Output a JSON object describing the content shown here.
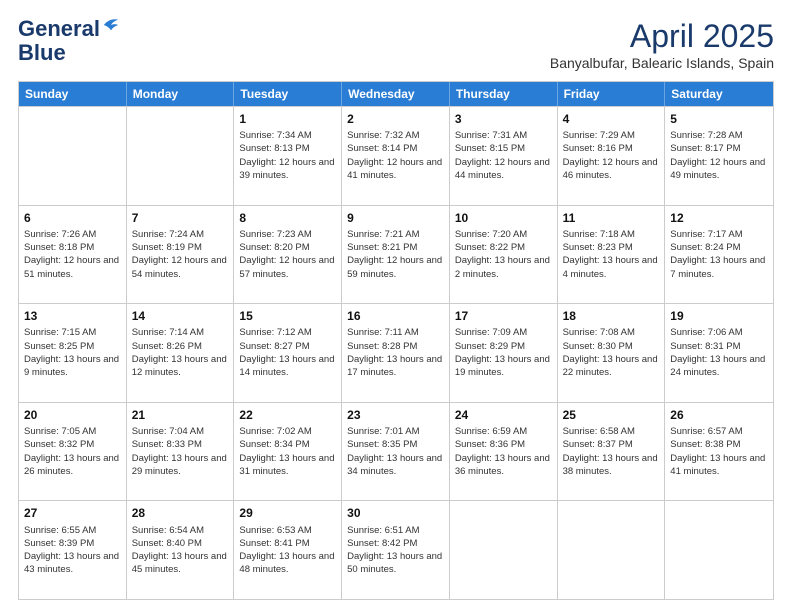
{
  "logo": {
    "general": "General",
    "blue": "Blue"
  },
  "title": "April 2025",
  "subtitle": "Banyalbufar, Balearic Islands, Spain",
  "headers": [
    "Sunday",
    "Monday",
    "Tuesday",
    "Wednesday",
    "Thursday",
    "Friday",
    "Saturday"
  ],
  "weeks": [
    [
      {
        "day": "",
        "info": ""
      },
      {
        "day": "",
        "info": ""
      },
      {
        "day": "1",
        "info": "Sunrise: 7:34 AM\nSunset: 8:13 PM\nDaylight: 12 hours and 39 minutes."
      },
      {
        "day": "2",
        "info": "Sunrise: 7:32 AM\nSunset: 8:14 PM\nDaylight: 12 hours and 41 minutes."
      },
      {
        "day": "3",
        "info": "Sunrise: 7:31 AM\nSunset: 8:15 PM\nDaylight: 12 hours and 44 minutes."
      },
      {
        "day": "4",
        "info": "Sunrise: 7:29 AM\nSunset: 8:16 PM\nDaylight: 12 hours and 46 minutes."
      },
      {
        "day": "5",
        "info": "Sunrise: 7:28 AM\nSunset: 8:17 PM\nDaylight: 12 hours and 49 minutes."
      }
    ],
    [
      {
        "day": "6",
        "info": "Sunrise: 7:26 AM\nSunset: 8:18 PM\nDaylight: 12 hours and 51 minutes."
      },
      {
        "day": "7",
        "info": "Sunrise: 7:24 AM\nSunset: 8:19 PM\nDaylight: 12 hours and 54 minutes."
      },
      {
        "day": "8",
        "info": "Sunrise: 7:23 AM\nSunset: 8:20 PM\nDaylight: 12 hours and 57 minutes."
      },
      {
        "day": "9",
        "info": "Sunrise: 7:21 AM\nSunset: 8:21 PM\nDaylight: 12 hours and 59 minutes."
      },
      {
        "day": "10",
        "info": "Sunrise: 7:20 AM\nSunset: 8:22 PM\nDaylight: 13 hours and 2 minutes."
      },
      {
        "day": "11",
        "info": "Sunrise: 7:18 AM\nSunset: 8:23 PM\nDaylight: 13 hours and 4 minutes."
      },
      {
        "day": "12",
        "info": "Sunrise: 7:17 AM\nSunset: 8:24 PM\nDaylight: 13 hours and 7 minutes."
      }
    ],
    [
      {
        "day": "13",
        "info": "Sunrise: 7:15 AM\nSunset: 8:25 PM\nDaylight: 13 hours and 9 minutes."
      },
      {
        "day": "14",
        "info": "Sunrise: 7:14 AM\nSunset: 8:26 PM\nDaylight: 13 hours and 12 minutes."
      },
      {
        "day": "15",
        "info": "Sunrise: 7:12 AM\nSunset: 8:27 PM\nDaylight: 13 hours and 14 minutes."
      },
      {
        "day": "16",
        "info": "Sunrise: 7:11 AM\nSunset: 8:28 PM\nDaylight: 13 hours and 17 minutes."
      },
      {
        "day": "17",
        "info": "Sunrise: 7:09 AM\nSunset: 8:29 PM\nDaylight: 13 hours and 19 minutes."
      },
      {
        "day": "18",
        "info": "Sunrise: 7:08 AM\nSunset: 8:30 PM\nDaylight: 13 hours and 22 minutes."
      },
      {
        "day": "19",
        "info": "Sunrise: 7:06 AM\nSunset: 8:31 PM\nDaylight: 13 hours and 24 minutes."
      }
    ],
    [
      {
        "day": "20",
        "info": "Sunrise: 7:05 AM\nSunset: 8:32 PM\nDaylight: 13 hours and 26 minutes."
      },
      {
        "day": "21",
        "info": "Sunrise: 7:04 AM\nSunset: 8:33 PM\nDaylight: 13 hours and 29 minutes."
      },
      {
        "day": "22",
        "info": "Sunrise: 7:02 AM\nSunset: 8:34 PM\nDaylight: 13 hours and 31 minutes."
      },
      {
        "day": "23",
        "info": "Sunrise: 7:01 AM\nSunset: 8:35 PM\nDaylight: 13 hours and 34 minutes."
      },
      {
        "day": "24",
        "info": "Sunrise: 6:59 AM\nSunset: 8:36 PM\nDaylight: 13 hours and 36 minutes."
      },
      {
        "day": "25",
        "info": "Sunrise: 6:58 AM\nSunset: 8:37 PM\nDaylight: 13 hours and 38 minutes."
      },
      {
        "day": "26",
        "info": "Sunrise: 6:57 AM\nSunset: 8:38 PM\nDaylight: 13 hours and 41 minutes."
      }
    ],
    [
      {
        "day": "27",
        "info": "Sunrise: 6:55 AM\nSunset: 8:39 PM\nDaylight: 13 hours and 43 minutes."
      },
      {
        "day": "28",
        "info": "Sunrise: 6:54 AM\nSunset: 8:40 PM\nDaylight: 13 hours and 45 minutes."
      },
      {
        "day": "29",
        "info": "Sunrise: 6:53 AM\nSunset: 8:41 PM\nDaylight: 13 hours and 48 minutes."
      },
      {
        "day": "30",
        "info": "Sunrise: 6:51 AM\nSunset: 8:42 PM\nDaylight: 13 hours and 50 minutes."
      },
      {
        "day": "",
        "info": ""
      },
      {
        "day": "",
        "info": ""
      },
      {
        "day": "",
        "info": ""
      }
    ]
  ]
}
